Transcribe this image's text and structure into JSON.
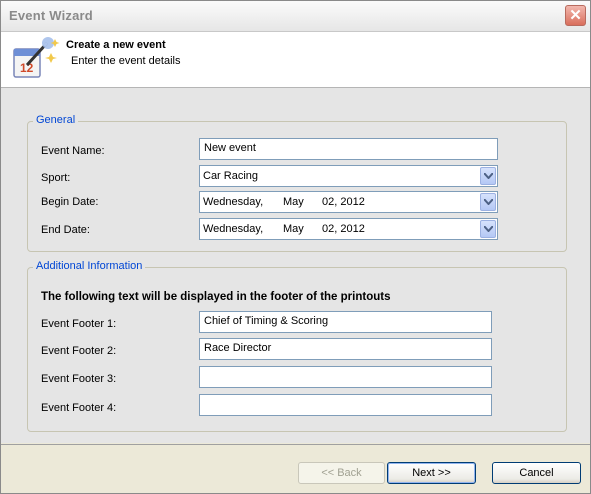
{
  "window": {
    "title": "Event Wizard"
  },
  "header": {
    "title": "Create a new event",
    "subtitle": "Enter the event details"
  },
  "general": {
    "legend": "General",
    "event_name_label": "Event Name:",
    "event_name_value": "New event",
    "sport_label": "Sport:",
    "sport_value": "Car Racing",
    "begin_date_label": "Begin Date:",
    "begin_date": {
      "weekday": "Wednesday,",
      "month": "May",
      "day_year": "02, 2012"
    },
    "end_date_label": "End Date:",
    "end_date": {
      "weekday": "Wednesday,",
      "month": "May",
      "day_year": "02, 2012"
    }
  },
  "additional": {
    "legend": "Additional Information",
    "note": "The following text will be displayed in the footer of the printouts",
    "footers": [
      {
        "label": "Event Footer 1:",
        "value": "Chief of Timing & Scoring"
      },
      {
        "label": "Event Footer 2:",
        "value": "Race Director"
      },
      {
        "label": "Event Footer 3:",
        "value": ""
      },
      {
        "label": "Event Footer 4:",
        "value": ""
      }
    ]
  },
  "buttons": {
    "back": "<< Back",
    "next": "Next >>",
    "cancel": "Cancel"
  },
  "colors": {
    "legend": "#0046d5",
    "window_bg": "#ece9d8",
    "body_bg": "#e5e5e5"
  }
}
